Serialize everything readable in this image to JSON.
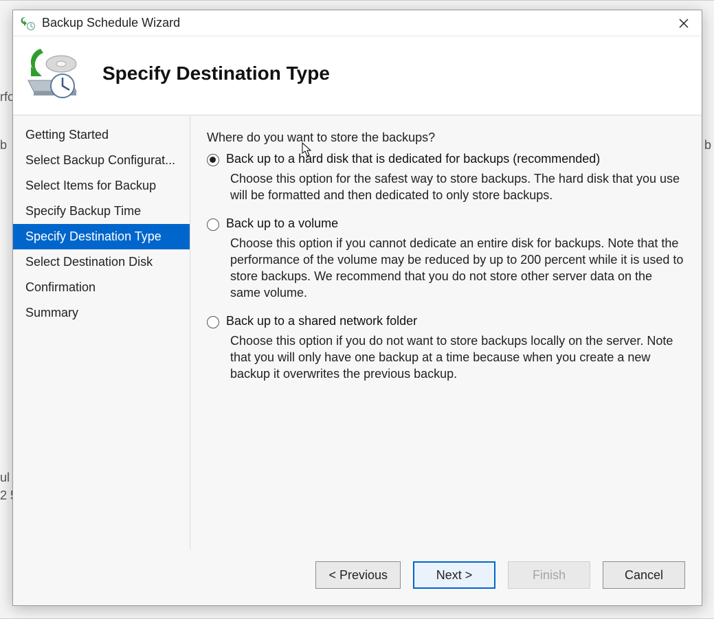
{
  "window": {
    "title": "Backup Schedule Wizard",
    "page_title": "Specify Destination Type"
  },
  "sidebar": {
    "steps": [
      "Getting Started",
      "Select Backup Configurat...",
      "Select Items for Backup",
      "Specify Backup Time",
      "Specify Destination Type",
      "Select Destination Disk",
      "Confirmation",
      "Summary"
    ],
    "active_index": 4
  },
  "content": {
    "prompt": "Where do you want to store the backups?",
    "options": [
      {
        "label": "Back up to a hard disk that is dedicated for backups (recommended)",
        "description": "Choose this option for the safest way to store backups. The hard disk that you use will be formatted and then dedicated to only store backups.",
        "selected": true
      },
      {
        "label": "Back up to a volume",
        "description": "Choose this option if you cannot dedicate an entire disk for backups. Note that the performance of the volume may be reduced by up to 200 percent while it is used to store backups. We recommend that you do not store other server data on the same volume.",
        "selected": false
      },
      {
        "label": "Back up to a shared network folder",
        "description": "Choose this option if you do not want to store backups locally on the server. Note that you will only have one backup at a time because when you create a new backup it overwrites the previous backup.",
        "selected": false
      }
    ]
  },
  "buttons": {
    "previous": "< Previous",
    "next": "Next >",
    "finish": "Finish",
    "cancel": "Cancel"
  },
  "background": {
    "frag1": "rfo",
    "frag2": "b",
    "frag3": "b",
    "frag4": "ul",
    "frag5": "2 5"
  }
}
